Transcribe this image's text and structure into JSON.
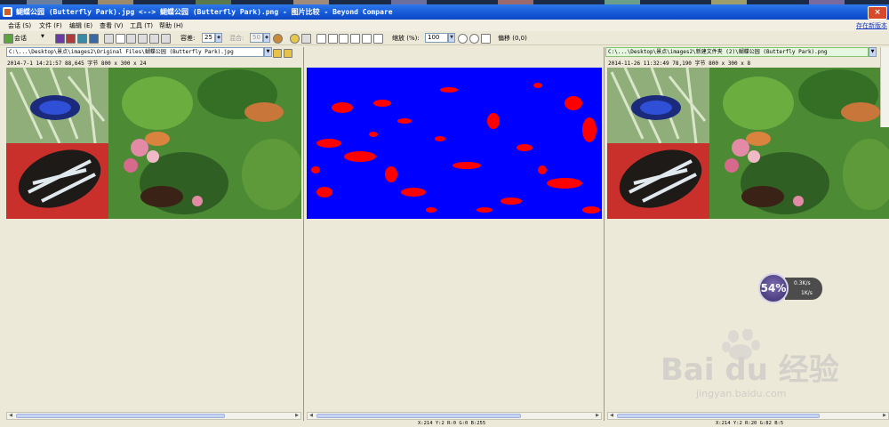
{
  "window": {
    "title": "蝴蝶公园 (Butterfly Park).jpg <--> 蝴蝶公园 (Butterfly Park).png - 图片比较 - Beyond Compare",
    "close_label": "×"
  },
  "menu": {
    "items": [
      "会话 (S)",
      "文件 (F)",
      "编辑 (E)",
      "查看 (V)",
      "工具 (T)",
      "帮助 (H)"
    ],
    "right_link": "存在新版本"
  },
  "toolbar": {
    "session_label": "会话",
    "tolerance_label": "容差:",
    "tolerance_value": "25",
    "blend_label": "混合:",
    "blend_value": "50",
    "zoom_label": "缩放 (%):",
    "zoom_value": "100",
    "offset_label": "偏移 (0,0)"
  },
  "left_file": {
    "path": "C:\\...\\Desktop\\景点\\images2\\Original Files\\蝴蝶公园 (Butterfly Park).jpg",
    "info": "2014-7-1 14:21:57  88,645 字节  800 x 300 x 24"
  },
  "right_file": {
    "path": "C:\\...\\Desktop\\景点\\images2\\新建文件夹 (2)\\蝴蝶公园 (Butterfly Park).png",
    "info": "2014-11-26 11:32:49  78,190 字节  800 x 300 x 8"
  },
  "status": {
    "center": "X:214 Y:2 R:0 G:0 B:255",
    "right": "X:214 Y:2 R:20 G:82 B:5"
  },
  "speed_widget": {
    "percent": "54%",
    "upload": "0.3K/s",
    "download": "1K/s"
  },
  "watermark": {
    "brand": "Bai du 经验",
    "url": "jingyan.baidu.com"
  },
  "colors": {
    "diff_background": "#0000ff",
    "diff_marks": "#ff0000",
    "titlebar": "#1458d6"
  }
}
